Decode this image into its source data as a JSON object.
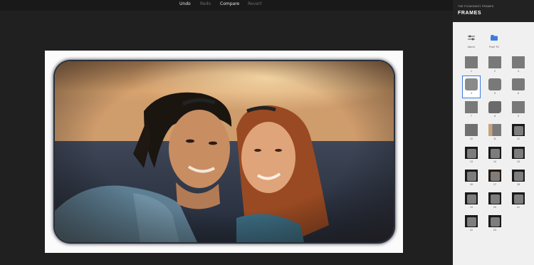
{
  "toolbar": {
    "undo": "Undo",
    "redo": "Redo",
    "compare": "Compare",
    "revert": "Revert"
  },
  "sidebar": {
    "title_small": "THE PICMONKEY FRAMES",
    "title": "FRAMES",
    "tools": [
      {
        "label": "Also in",
        "icon": "sliders-icon"
      },
      {
        "label": "From TG",
        "icon": "folder-icon"
      }
    ],
    "frames": [
      "1",
      "2",
      "3",
      "4",
      "5",
      "6",
      "7",
      "8",
      "9",
      "10",
      "11",
      "12",
      "13",
      "14",
      "15",
      "16",
      "17",
      "18",
      "19",
      "20",
      "21",
      "22",
      "23"
    ]
  },
  "colors": {
    "accent": "#3d7be0",
    "toolbar_bg": "#191919",
    "sidebar_bg": "#f0f0f0"
  }
}
